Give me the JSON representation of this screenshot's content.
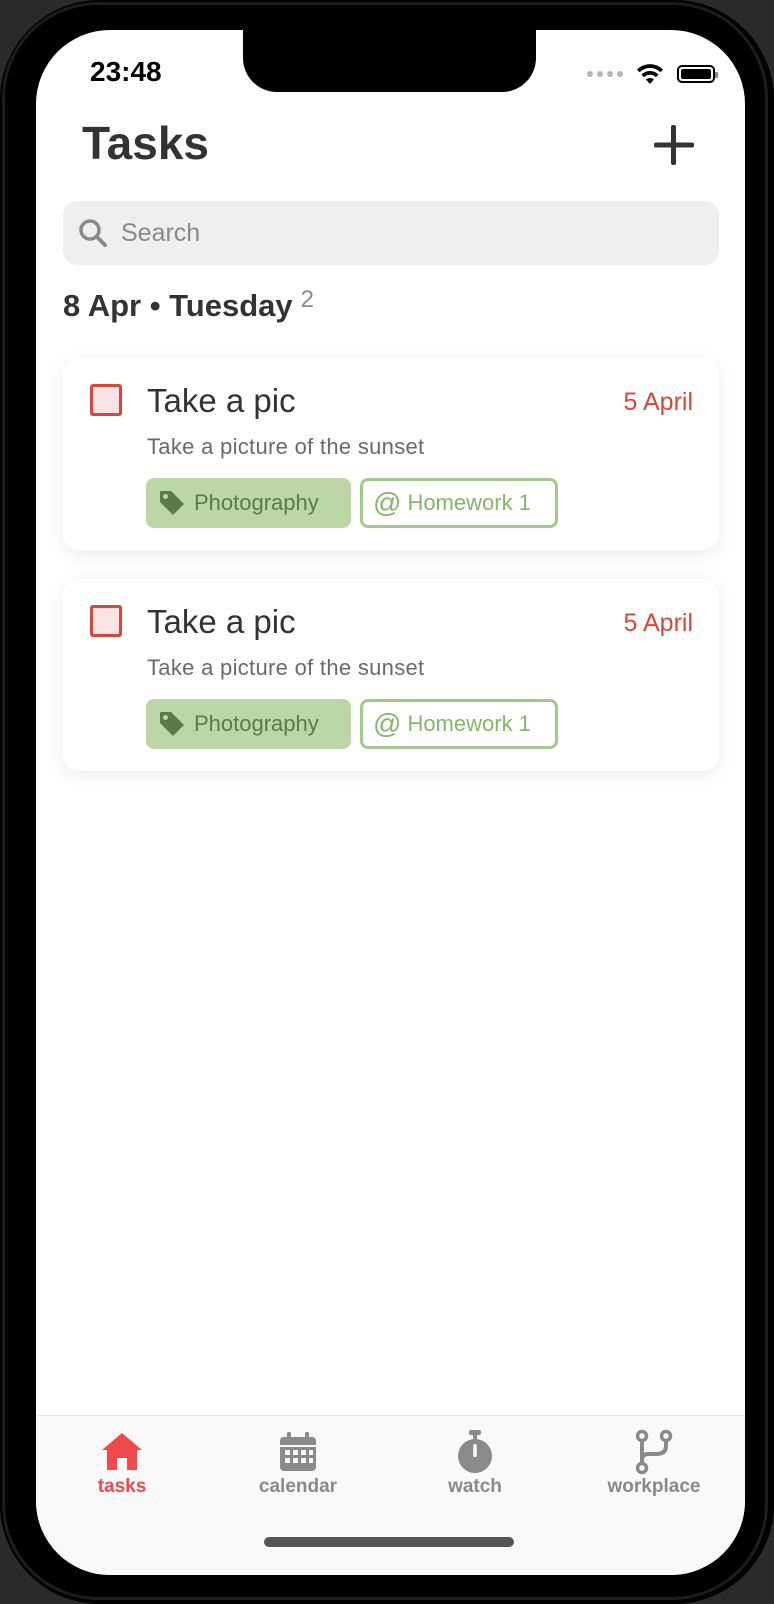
{
  "status_bar": {
    "time": "23:48"
  },
  "header": {
    "title": "Tasks"
  },
  "search": {
    "placeholder": "Search"
  },
  "section": {
    "date": "8 Apr • Tuesday",
    "count": "2"
  },
  "tasks": [
    {
      "title": "Take a pic",
      "due": "5 April",
      "description": "Take a picture of the sunset",
      "tag": "Photography",
      "project": "Homework 1"
    },
    {
      "title": "Take a pic",
      "due": "5 April",
      "description": "Take a picture of the sunset",
      "tag": "Photography",
      "project": "Homework 1"
    }
  ],
  "tabbar": {
    "items": [
      {
        "label": "tasks",
        "icon": "home-icon",
        "active": true
      },
      {
        "label": "calendar",
        "icon": "calendar-icon",
        "active": false
      },
      {
        "label": "watch",
        "icon": "stopwatch-icon",
        "active": false
      },
      {
        "label": "workplace",
        "icon": "branch-icon",
        "active": false
      }
    ]
  },
  "colors": {
    "accent": "#f0494b",
    "due_date": "#d9473a",
    "tag_bg": "#bcd6a8",
    "project_border": "#a4c98c"
  }
}
